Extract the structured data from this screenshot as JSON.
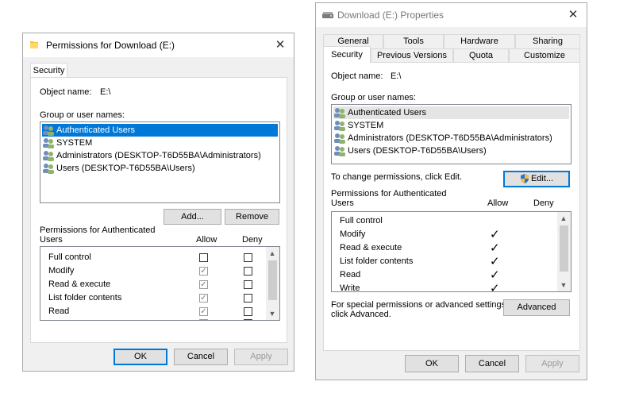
{
  "left_window": {
    "title": "Permissions for Download (E:)",
    "close_glyph": "✕",
    "tab_security": "Security",
    "object_name_label": "Object name:",
    "object_name_value": "E:\\",
    "group_label": "Group or user names:",
    "users": [
      "Authenticated Users",
      "SYSTEM",
      "Administrators (DESKTOP-T6D55BA\\Administrators)",
      "Users (DESKTOP-T6D55BA\\Users)"
    ],
    "add_label": "Add...",
    "remove_label": "Remove",
    "permissions_for_line1": "Permissions for Authenticated",
    "permissions_for_line2": "Users",
    "allow_label": "Allow",
    "deny_label": "Deny",
    "permissions": [
      {
        "name": "Full control",
        "allow": false
      },
      {
        "name": "Modify",
        "allow": true
      },
      {
        "name": "Read & execute",
        "allow": true
      },
      {
        "name": "List folder contents",
        "allow": true
      },
      {
        "name": "Read",
        "allow": true
      }
    ],
    "ok_label": "OK",
    "cancel_label": "Cancel",
    "apply_label": "Apply"
  },
  "right_window": {
    "title": "Download (E:) Properties",
    "close_glyph": "✕",
    "tabs_row1": [
      "General",
      "Tools",
      "Hardware",
      "Sharing"
    ],
    "tabs_row2": [
      "Security",
      "Previous Versions",
      "Quota",
      "Customize"
    ],
    "object_name_label": "Object name:",
    "object_name_value": "E:\\",
    "group_label": "Group or user names:",
    "users": [
      "Authenticated Users",
      "SYSTEM",
      "Administrators (DESKTOP-T6D55BA\\Administrators)",
      "Users (DESKTOP-T6D55BA\\Users)"
    ],
    "change_text": "To change permissions, click Edit.",
    "edit_label": "Edit...",
    "permissions_for_line1": "Permissions for Authenticated",
    "permissions_for_line2": "Users",
    "allow_label": "Allow",
    "deny_label": "Deny",
    "permissions": [
      {
        "name": "Full control",
        "allow": false
      },
      {
        "name": "Modify",
        "allow": true
      },
      {
        "name": "Read & execute",
        "allow": true
      },
      {
        "name": "List folder contents",
        "allow": true
      },
      {
        "name": "Read",
        "allow": true
      },
      {
        "name": "Write",
        "allow": true
      }
    ],
    "special_line1": "For special permissions or advanced settings,",
    "special_line2": "click Advanced.",
    "advanced_label": "Advanced",
    "ok_label": "OK",
    "cancel_label": "Cancel",
    "apply_label": "Apply"
  },
  "colors": {
    "selection": "#0078d7",
    "focus_border": "#0078d7"
  }
}
